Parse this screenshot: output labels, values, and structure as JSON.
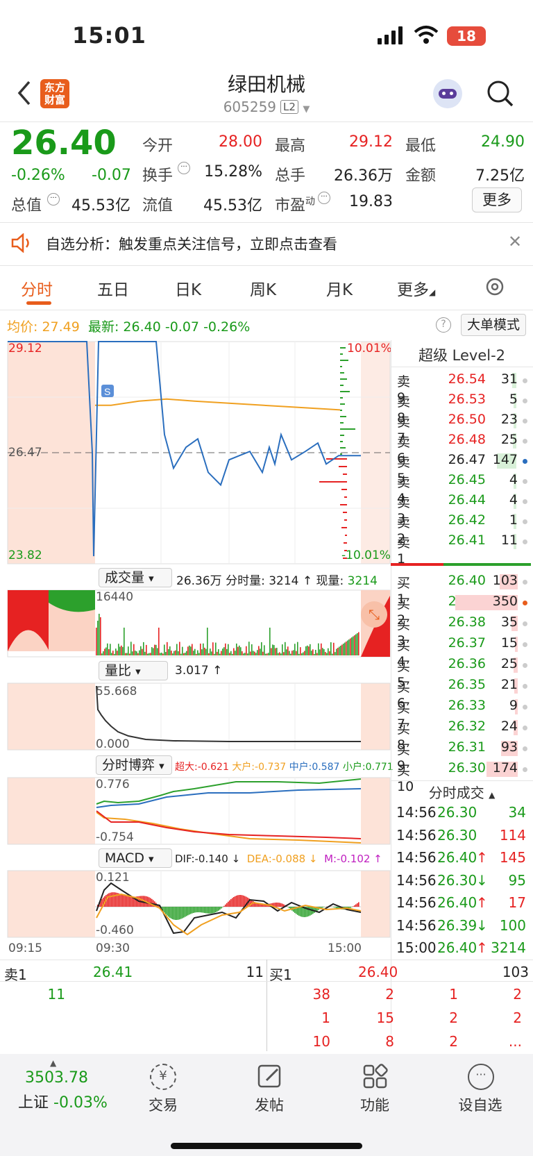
{
  "status": {
    "time": "15:01",
    "battery": "18"
  },
  "header": {
    "title": "绿田机械",
    "code": "605259",
    "level": "L2",
    "logo_line1": "东方",
    "logo_line2": "财富"
  },
  "quote": {
    "price": "26.40",
    "change_pct": "-0.26%",
    "change": "-0.07",
    "open_label": "今开",
    "open": "28.00",
    "high_label": "最高",
    "high": "29.12",
    "low_label": "最低",
    "low": "24.90",
    "turnover_label": "换手",
    "turnover": "15.28%",
    "volume_label": "总手",
    "volume": "26.36万",
    "amount_label": "金额",
    "amount": "7.25亿",
    "mktcap_label": "总值",
    "mktcap": "45.53亿",
    "float_label": "流值",
    "float": "45.53亿",
    "pe_label": "市盈",
    "pe_sup": "动",
    "pe": "19.83",
    "more_button": "更多"
  },
  "notice": {
    "text": "自选分析：触发重点关注信号，立即点击查看"
  },
  "tabs": [
    "分时",
    "五日",
    "日K",
    "周K",
    "月K",
    "更多"
  ],
  "infoline": {
    "avg_label": "均价:",
    "avg": "27.49",
    "last_label": "最新:",
    "last": "26.40",
    "chg": "-0.07",
    "pct": "-0.26%",
    "mode_button": "大单模式"
  },
  "chart": {
    "price_high": "29.12",
    "price_ref": "26.47",
    "price_low": "23.82",
    "pct_high": "10.01%",
    "pct_low": "-10.01%",
    "vol_button": "成交量",
    "vol_info": "26.36万 分时量: 3214 ↑ 现量:",
    "vol_now": "3214",
    "vol_max": "16440",
    "ratio_button": "量比",
    "ratio_info": "3.017 ↑",
    "ratio_max": "55.668",
    "ratio_min": "0.000",
    "game_button": "分时博弈",
    "game_super": "超大:-0.621",
    "game_large": "大户:-0.737",
    "game_mid": "中户:0.587",
    "game_small": "小户:0.771",
    "game_max": "0.776",
    "game_min": "-0.754",
    "macd_button": "MACD",
    "dif": "DIF:-0.140 ↓",
    "dea": "DEA:-0.088 ↓",
    "m": "M:-0.102 ↑",
    "macd_max": "0.121",
    "macd_min": "-0.460",
    "t1": "09:15",
    "t2": "09:30",
    "t3": "15:00"
  },
  "chart_data": {
    "type": "line",
    "title": "",
    "xlabel": "",
    "ylabel": "",
    "x": [
      "09:15",
      "09:30",
      "15:00"
    ],
    "ylim": [
      23.82,
      29.12
    ],
    "series": [
      {
        "values": [
          29.12,
          29.12,
          26.47,
          24.0,
          29.12,
          29.12,
          29.12,
          26.9,
          26.1,
          26.6,
          26.8,
          26.0,
          25.7,
          26.3,
          26.4,
          26.5,
          26.0,
          26.6,
          26.2,
          26.9,
          26.3,
          26.5,
          26.7,
          26.2,
          26.4,
          26.4
        ]
      }
    ],
    "avg_line": [
      27.6,
      27.6,
      27.7,
      27.75,
      27.7,
      27.65,
      27.6,
      27.55,
      27.5,
      27.49
    ]
  },
  "orderbook": {
    "title": "超级 Level-2",
    "asks": [
      {
        "label": "卖9",
        "price": "26.54",
        "vol": "31"
      },
      {
        "label": "卖8",
        "price": "26.53",
        "vol": "5"
      },
      {
        "label": "卖7",
        "price": "26.50",
        "vol": "23"
      },
      {
        "label": "卖6",
        "price": "26.48",
        "vol": "25"
      },
      {
        "label": "卖5",
        "price": "26.47",
        "vol": "147"
      },
      {
        "label": "卖4",
        "price": "26.45",
        "vol": "4"
      },
      {
        "label": "卖3",
        "price": "26.44",
        "vol": "4"
      },
      {
        "label": "卖2",
        "price": "26.42",
        "vol": "1"
      },
      {
        "label": "卖1",
        "price": "26.41",
        "vol": "11"
      }
    ],
    "bids": [
      {
        "label": "买1",
        "price": "26.40",
        "vol": "103"
      },
      {
        "label": "买2",
        "price": "26.39",
        "vol": "350"
      },
      {
        "label": "买3",
        "price": "26.38",
        "vol": "35"
      },
      {
        "label": "买4",
        "price": "26.37",
        "vol": "15"
      },
      {
        "label": "买5",
        "price": "26.36",
        "vol": "25"
      },
      {
        "label": "买6",
        "price": "26.35",
        "vol": "21"
      },
      {
        "label": "买7",
        "price": "26.33",
        "vol": "9"
      },
      {
        "label": "买8",
        "price": "26.32",
        "vol": "24"
      },
      {
        "label": "买9",
        "price": "26.31",
        "vol": "93"
      },
      {
        "label": "买10",
        "price": "26.30",
        "vol": "174"
      }
    ],
    "trades_title": "分时成交",
    "trades": [
      {
        "time": "14:56",
        "price": "26.30",
        "arrow": "",
        "vol": "34",
        "pc": "green",
        "vc": "green"
      },
      {
        "time": "14:56",
        "price": "26.30",
        "arrow": "",
        "vol": "114",
        "pc": "green",
        "vc": "red"
      },
      {
        "time": "14:56",
        "price": "26.40",
        "arrow": "↑",
        "vol": "145",
        "pc": "green",
        "vc": "red"
      },
      {
        "time": "14:56",
        "price": "26.30",
        "arrow": "↓",
        "vol": "95",
        "pc": "green",
        "vc": "green"
      },
      {
        "time": "14:56",
        "price": "26.40",
        "arrow": "↑",
        "vol": "17",
        "pc": "green",
        "vc": "red"
      },
      {
        "time": "14:56",
        "price": "26.39",
        "arrow": "↓",
        "vol": "100",
        "pc": "green",
        "vc": "green"
      },
      {
        "time": "15:00",
        "price": "26.40",
        "arrow": "↑",
        "vol": "3214",
        "pc": "green",
        "vc": "green"
      }
    ]
  },
  "queue": {
    "sell_label": "卖1",
    "sell_price": "26.41",
    "sell_vol": "11",
    "buy_label": "买1",
    "buy_price": "26.40",
    "buy_vol": "103",
    "sell_orders": [
      "11"
    ],
    "buy_orders": [
      "38",
      "2",
      "1",
      "2",
      "1",
      "15",
      "2",
      "2",
      "10",
      "8",
      "2",
      "..."
    ]
  },
  "bottom": {
    "index_value": "3503.78",
    "index_name": "上证",
    "index_chg": "-0.03%",
    "items": [
      "交易",
      "发帖",
      "功能",
      "设自选"
    ]
  }
}
